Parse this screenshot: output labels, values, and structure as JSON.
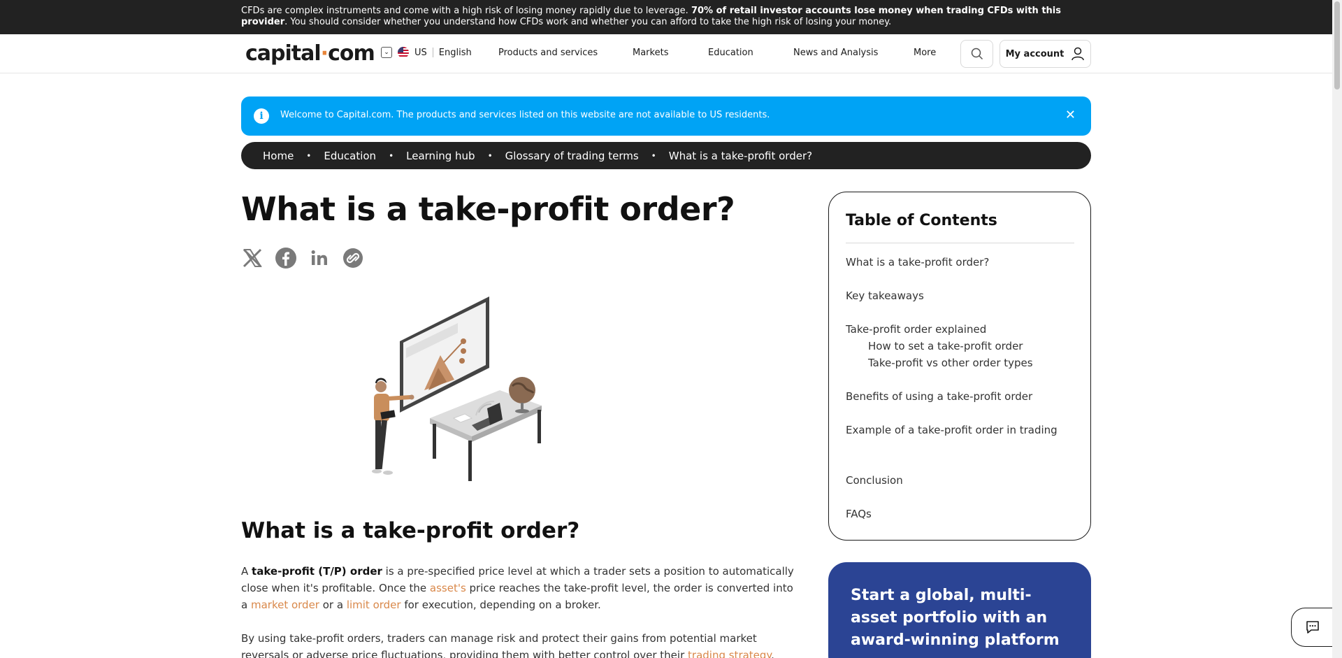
{
  "risk_warning": {
    "before": "CFDs are complex instruments and come with a high risk of losing money rapidly due to leverage. ",
    "bold": "70% of retail investor accounts lose money when trading CFDs with this provider",
    "after": ". You should consider whether you understand how CFDs work and whether you can afford to take the high risk of losing your money."
  },
  "header": {
    "logo_left": "capital",
    "logo_dot": "·",
    "logo_right": "com",
    "country": "US",
    "language": "English",
    "nav": [
      "Products and services",
      "Markets",
      "Education",
      "News and Analysis",
      "More"
    ],
    "account_label": "My account"
  },
  "info_banner": {
    "icon": "i",
    "text": "Welcome to Capital.com. The products and services listed on this website are not available to US residents.",
    "close": "✕"
  },
  "breadcrumb": [
    "Home",
    "Education",
    "Learning hub",
    "Glossary of trading terms",
    "What is a take-profit order?"
  ],
  "breadcrumb_sep": "•",
  "article": {
    "title": "What is a take-profit order?",
    "section_title": "What is a take-profit order?",
    "p1": {
      "t1": "A ",
      "b1": "take-profit (T/P) order",
      "t2": " is a pre-specified price level at which a trader sets a position to automatically close when it's profitable. Once the ",
      "l1": "asset's",
      "t3": " price reaches the take-profit level, the order is converted into a ",
      "l2": "market order",
      "t4": " or a ",
      "l3": "limit order",
      "t5": " for execution, depending on a broker."
    },
    "p2": {
      "t1": "By using take-profit orders, traders can manage risk and protect their gains from potential market reversals or adverse price fluctuations, providing them with better control over their ",
      "l1": "trading strategy",
      "t2": "."
    }
  },
  "share_icons": [
    "x-icon",
    "facebook-icon",
    "linkedin-icon",
    "link-icon"
  ],
  "toc": {
    "title": "Table of Contents",
    "items": [
      "What is a take-profit order?",
      "Key takeaways",
      "Take-profit order explained",
      "How to set a take-profit order",
      "Take-profit vs other order types",
      "Benefits of using a take-profit order",
      "Example of a take-profit order in trading",
      "Conclusion",
      "FAQs"
    ]
  },
  "promo": {
    "text": "Start a global, multi-asset portfolio with an award-winning platform"
  },
  "colors": {
    "accent": "#e8853a",
    "link": "#d9884a",
    "banner": "#00a3f5",
    "promo": "#2b4494",
    "dark": "#222222"
  }
}
